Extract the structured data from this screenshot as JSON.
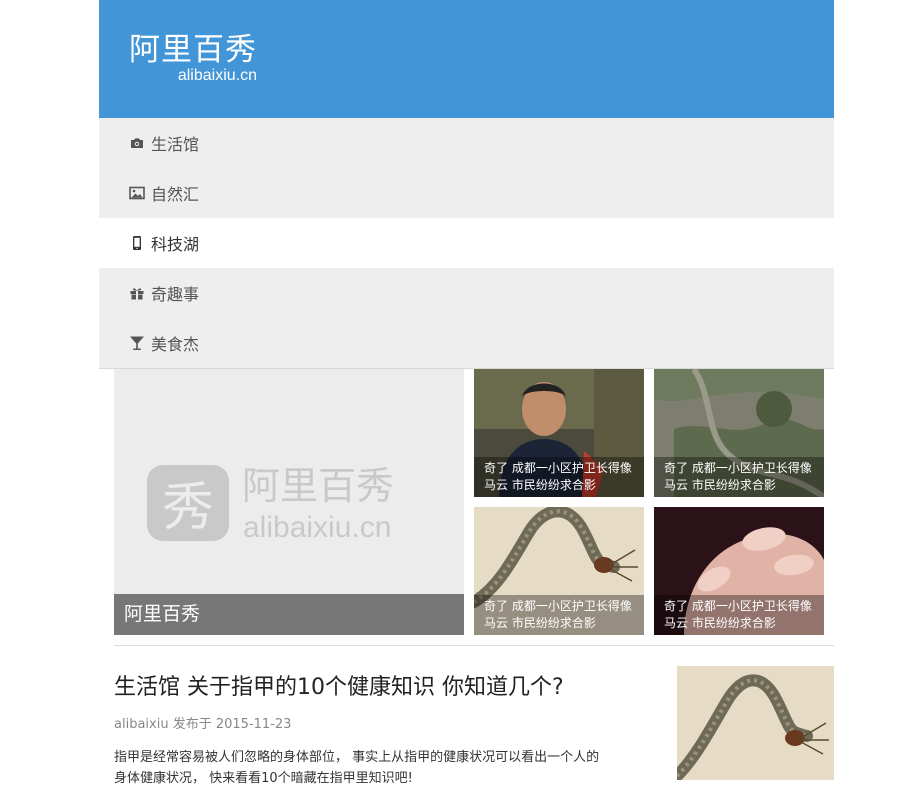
{
  "site": {
    "logo_cn": "阿里百秀",
    "logo_en": "alibaixiu.cn",
    "brand_color": "#4296d7"
  },
  "nav": {
    "items": [
      {
        "label": "生活馆",
        "icon": "camera-icon",
        "active": false
      },
      {
        "label": "自然汇",
        "icon": "image-icon",
        "active": false
      },
      {
        "label": "科技湖",
        "icon": "mobile-icon",
        "active": true
      },
      {
        "label": "奇趣事",
        "icon": "gift-icon",
        "active": false
      },
      {
        "label": "美食杰",
        "icon": "cocktail-icon",
        "active": false
      }
    ]
  },
  "slider": {
    "caption": "阿里百秀",
    "watermark_cn": "阿里百秀",
    "watermark_en": "alibaixiu.cn",
    "watermark_glyph": "秀"
  },
  "thumbs": [
    {
      "line1": "奇了 成都一小区护卫长得像",
      "line2": "马云 市民纷纷求合影"
    },
    {
      "line1": "奇了 成都一小区护卫长得像",
      "line2": "马云 市民纷纷求合影"
    },
    {
      "line1": "奇了 成都一小区护卫长得像",
      "line2": "马云 市民纷纷求合影"
    },
    {
      "line1": "奇了 成都一小区护卫长得像",
      "line2": "马云 市民纷纷求合影"
    }
  ],
  "article": {
    "title": "生活馆 关于指甲的10个健康知识 你知道几个?",
    "meta": "alibaixiu 发布于 2015-11-23",
    "excerpt_line1": "指甲是经常容易被人们忽略的身体部位， 事实上从指甲的健康状况可以看出一个人的",
    "excerpt_line2": "身体健康状况， 快来看看10个暗藏在指甲里知识吧!"
  }
}
